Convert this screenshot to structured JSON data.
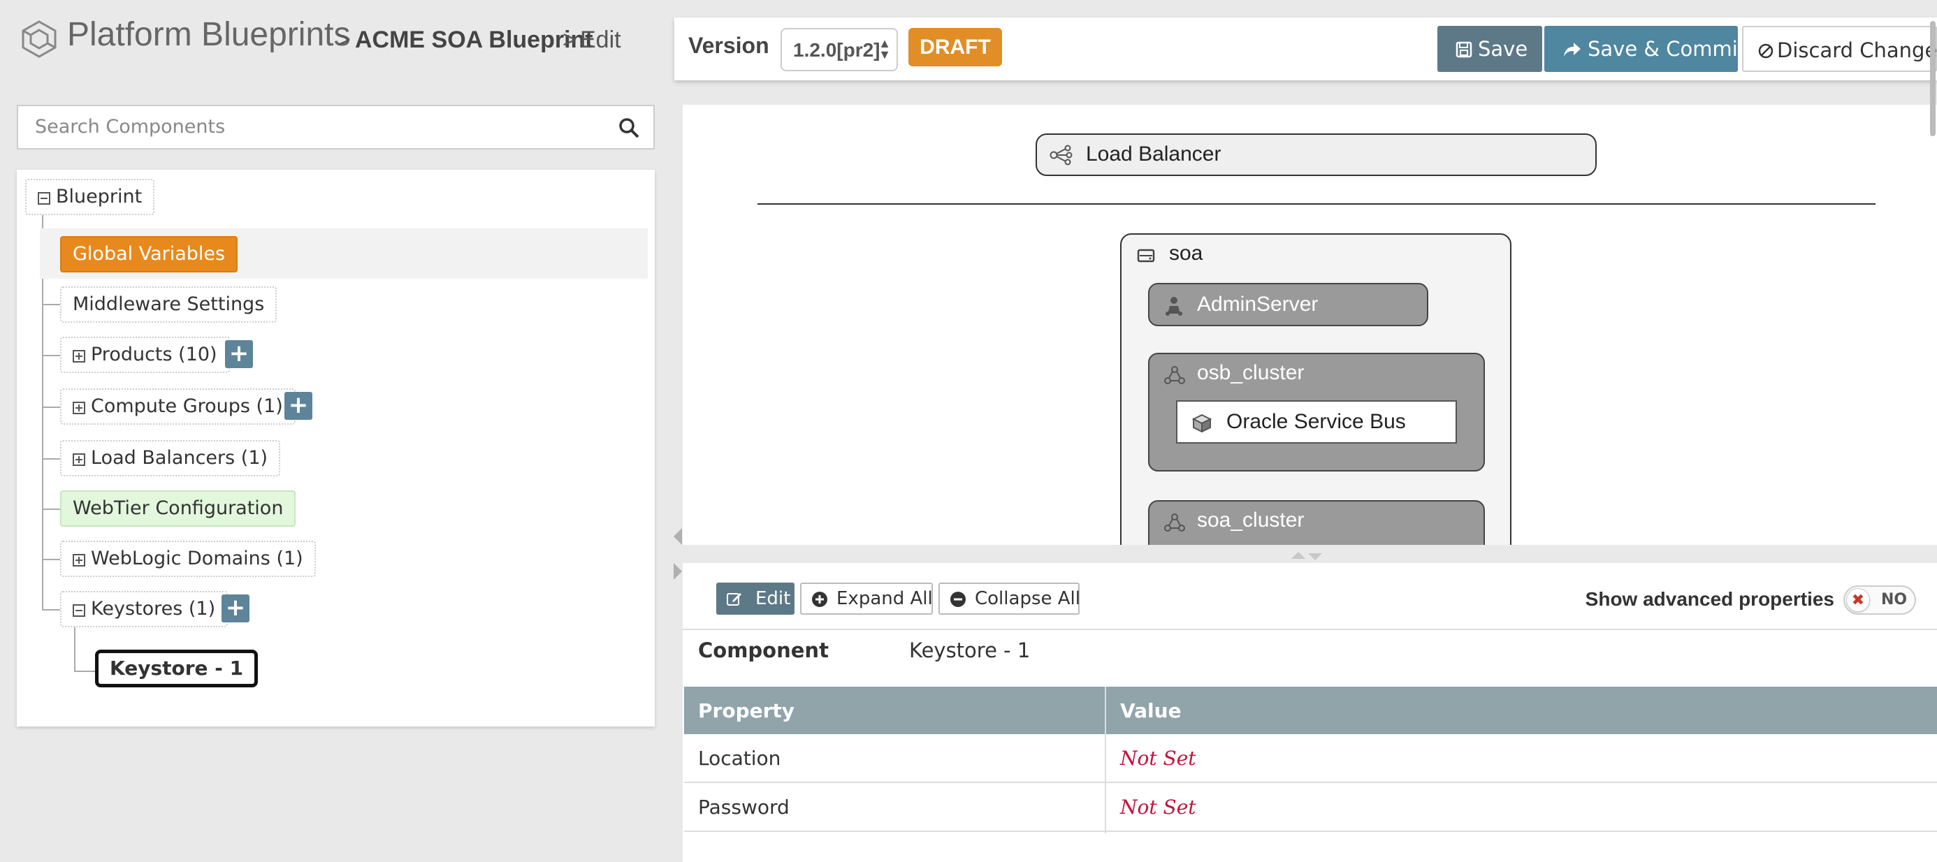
{
  "header": {
    "title": "Platform Blueprints",
    "breadcrumb_sep1": ">",
    "breadcrumb_blueprint": "ACME SOA Blueprint",
    "breadcrumb_sep2": ">",
    "breadcrumb_action": "Edit"
  },
  "toolbar": {
    "version_label": "Version",
    "version_value": "1.2.0[pr2]",
    "status_badge": "DRAFT",
    "save_label": "Save",
    "commit_label": "Save & Commit",
    "discard_label": "Discard Changes"
  },
  "search": {
    "placeholder": "Search Components"
  },
  "tree": {
    "root": "Blueprint",
    "items": [
      {
        "label": "Global Variables"
      },
      {
        "label": "Middleware Settings"
      },
      {
        "label": "Products (10)"
      },
      {
        "label": "Compute Groups (1)"
      },
      {
        "label": "Load Balancers (1)"
      },
      {
        "label": "WebTier Configuration"
      },
      {
        "label": "WebLogic Domains (1)"
      },
      {
        "label": "Keystores (1)"
      }
    ],
    "selected_child": "Keystore - 1",
    "add_symbol": "+"
  },
  "canvas": {
    "load_balancer": "Load Balancer",
    "group_name": "soa",
    "admin_server": "AdminServer",
    "cluster1": "osb_cluster",
    "cluster1_product": "Oracle Service Bus",
    "cluster2": "soa_cluster"
  },
  "details": {
    "edit_label": "Edit",
    "expand_label": "Expand All",
    "collapse_label": "Collapse All",
    "advanced_label": "Show advanced properties",
    "toggle_state": "NO",
    "toggle_mark": "✖",
    "component_label": "Component",
    "component_value": "Keystore - 1",
    "table_headers": [
      "Property",
      "Value"
    ],
    "rows": [
      {
        "property": "Location",
        "value": "Not Set"
      },
      {
        "property": "Password",
        "value": "Not Set"
      }
    ]
  },
  "colors": {
    "accent_orange": "#e08e25",
    "button_blue": "#4f86a0",
    "button_slate": "#5d7987",
    "not_set_red": "#c0143c"
  }
}
